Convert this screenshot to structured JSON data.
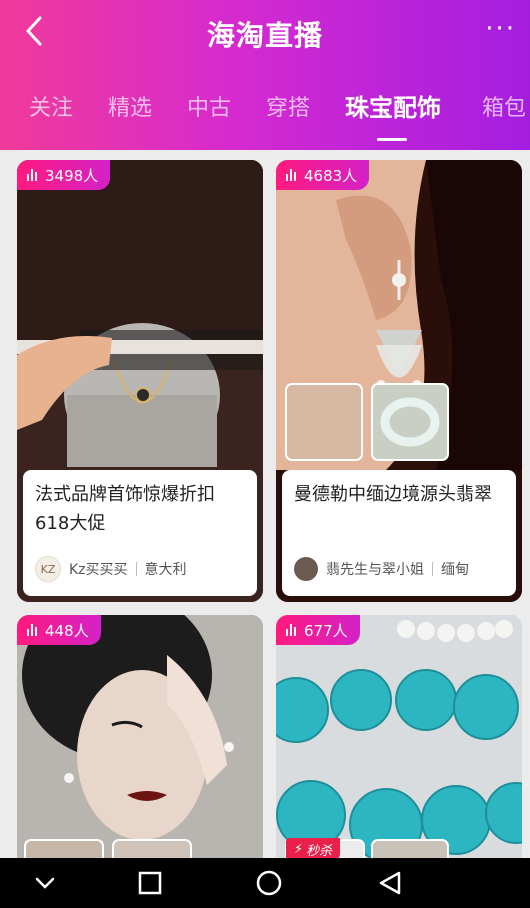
{
  "header": {
    "title": "海淘直播",
    "more": "···"
  },
  "tabs": [
    {
      "label": "关注"
    },
    {
      "label": "精选"
    },
    {
      "label": "中古"
    },
    {
      "label": "穿搭"
    },
    {
      "label": "珠宝配饰",
      "active": true
    },
    {
      "label": "箱包"
    }
  ],
  "cards": [
    {
      "viewers": "3498人",
      "title": "法式品牌首饰惊爆折扣618大促",
      "host": "Kz买买买",
      "avatar_text": "KZ",
      "location": "意大利"
    },
    {
      "viewers": "4683人",
      "title": "曼德勒中缅边境源头翡翠",
      "host": "翡先生与翠小姐",
      "location": "缅甸"
    },
    {
      "viewers": "448人"
    },
    {
      "viewers": "677人",
      "flash_tag": "秒杀"
    }
  ],
  "colors": {
    "accent_pink": "#f03a9a",
    "accent_purple": "#a41ee0"
  },
  "icons": [
    "back-icon",
    "more-icon",
    "live-bars-icon",
    "nav-down-icon",
    "nav-square-icon",
    "nav-circle-icon",
    "nav-back-icon"
  ]
}
